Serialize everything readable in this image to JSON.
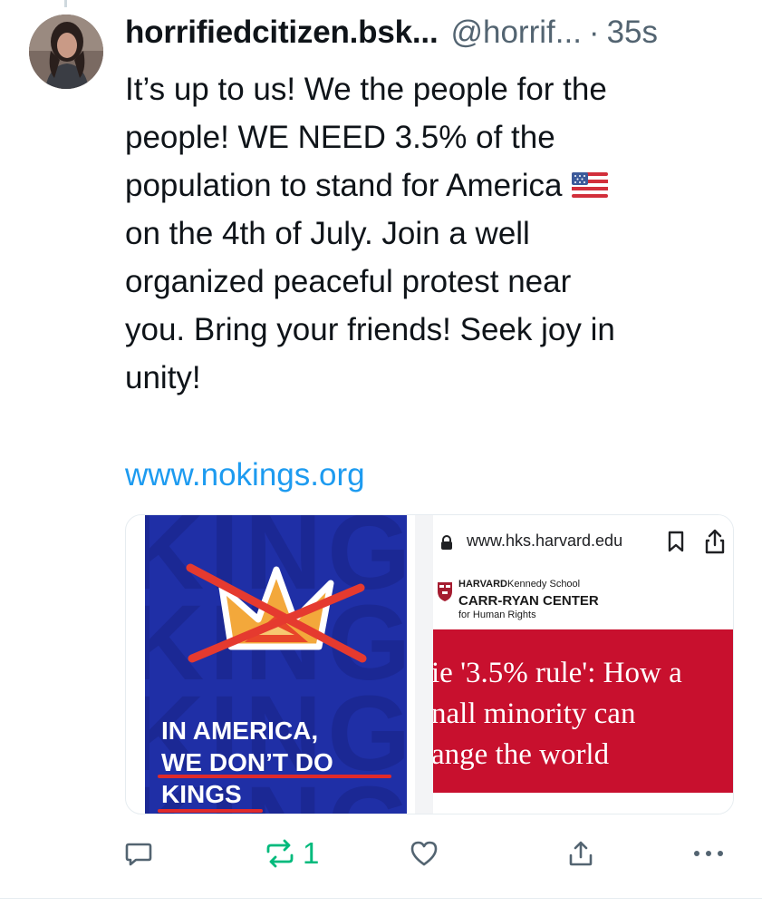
{
  "post": {
    "display_name": "horrifiedcitizen.bsk...",
    "handle": "@horrif...",
    "separator": "·",
    "time": "35s",
    "text_lines": [
      "It’s up to us!  We the people for the",
      "people!  WE NEED 3.5% of the",
      "population to stand for America",
      "on the 4th of July.  Join a well",
      "organized peaceful protest near",
      "you.  Bring your friends!  Seek joy in",
      "unity!"
    ],
    "link": "www.nokings.org"
  },
  "media": {
    "left_image": {
      "background_words": [
        "KINGS NO",
        "KINGS NO",
        "KINGS NO",
        "KINGS NO"
      ],
      "caption_lines": [
        "IN AMERICA,",
        "WE DON’T DO",
        "KINGS"
      ]
    },
    "right_image": {
      "url": "www.hks.harvard.edu",
      "school": "HARVARD",
      "school_sub": "Kennedy School",
      "center": "CARR-RYAN CENTER",
      "center_sub": "for Human Rights",
      "headline_lines": [
        "ie '3.5% rule': How a",
        "nall minority can",
        "ange the world"
      ]
    }
  },
  "actions": {
    "reply_icon": "reply-icon",
    "repost_icon": "repost-icon",
    "repost_count": "1",
    "like_icon": "heart-icon",
    "share_icon": "share-icon",
    "more_icon": "more-icon"
  },
  "colors": {
    "link": "#1d9bf0",
    "muted": "#536471",
    "repost": "#00ba7c",
    "poster_blue": "#1f2fa6",
    "harvard_red": "#c8102e"
  }
}
